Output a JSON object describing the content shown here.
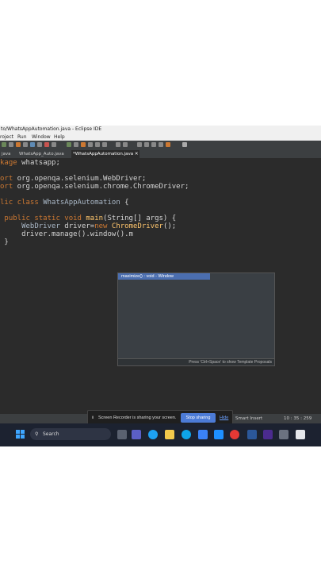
{
  "window": {
    "title": "to/WhatsAppAutomation.java - Eclipse IDE"
  },
  "menu": [
    "roject",
    "Run",
    "Window",
    "Help"
  ],
  "tabs": [
    {
      "label": "java"
    },
    {
      "label": "WhatsApp_Auto.java"
    },
    {
      "label": "*WhatsAppAutomation.java ✕"
    }
  ],
  "code": {
    "l1": {
      "kw": "kage",
      "rest": " whatsapp;"
    },
    "l2": {
      "kw": "ort",
      "rest": " org.openqa.selenium.WebDriver;"
    },
    "l3": {
      "kw": "ort",
      "rest": " org.openqa.selenium.chrome.ChromeDriver;"
    },
    "l4": {
      "kw": "lic class",
      "name": " WhatsAppAutomation",
      "rest": " {"
    },
    "l5": {
      "kw": " public static void",
      "fn": " main",
      "rest": "(String[] args) {"
    },
    "l6": {
      "ty": "     WebDriver",
      "var": " driver",
      "op": "=",
      "kw": "new",
      "fn": " ChromeDriver",
      "rest": "();"
    },
    "l7": {
      "rest": "     driver.manage().window().m"
    },
    "l8": {
      "rest": " }"
    }
  },
  "popup": {
    "item": "maximize() : void - Window",
    "hint": "Press 'Ctrl+Space' to show Template Proposals"
  },
  "status": {
    "mode": "Smart Insert",
    "position": "10 : 35 : 259"
  },
  "sharing": {
    "message": "Screen Recorder is sharing your screen.",
    "stop": "Stop sharing",
    "hide": "Hide"
  },
  "taskbar": {
    "search": "Search"
  },
  "colors": {
    "accent": "#4c7bd6",
    "editor_bg": "#2b2b2b",
    "keyword": "#cc7832"
  }
}
